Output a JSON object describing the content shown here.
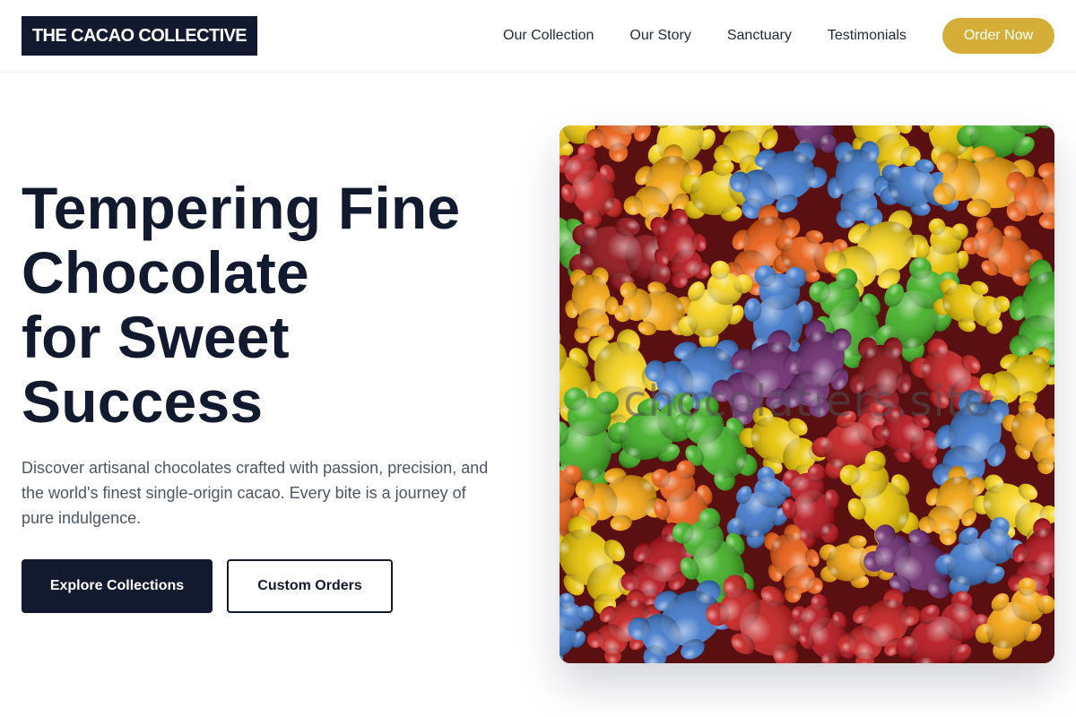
{
  "header": {
    "logo_text": "THE CACAO COLLECTIVE",
    "nav": [
      {
        "label": "Our Collection"
      },
      {
        "label": "Our Story"
      },
      {
        "label": "Sanctuary"
      },
      {
        "label": "Testimonials"
      }
    ],
    "order_button": "Order Now"
  },
  "hero": {
    "title_lines": [
      "Tempering Fine",
      "Chocolate",
      "for Sweet",
      "Success"
    ],
    "description": "Discover artisanal chocolates crafted with passion, precision, and the world's finest single-origin cacao. Every bite is a journey of pure indulgence.",
    "primary_button": "Explore Collections",
    "secondary_button": "Custom Orders",
    "image": {
      "subject": "gummy-bears-photo",
      "watermark": "chocolatiers.site"
    }
  },
  "colors": {
    "brand_dark": "#111a2e",
    "accent_gold": "#d4ae37",
    "body_text": "#4b5563"
  }
}
